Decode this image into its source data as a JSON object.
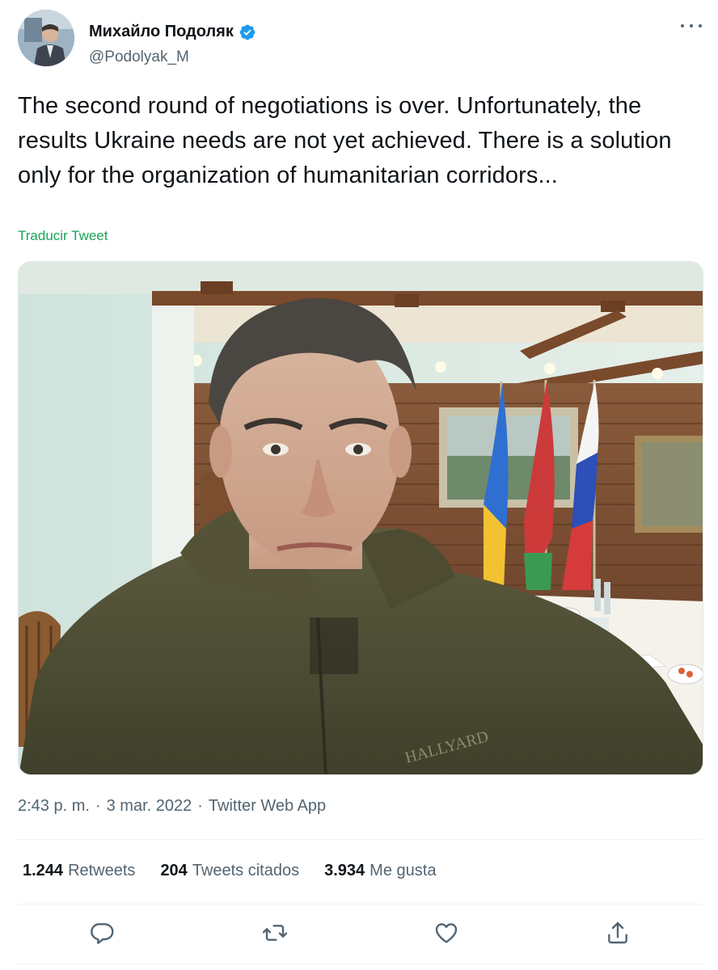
{
  "author": {
    "display_name": "Михайло Подоляк",
    "handle": "@Podolyak_M",
    "verified": true,
    "avatar_icon": "avatar-photo"
  },
  "tweet": {
    "text": "The second round of negotiations is over. Unfortunately, the results Ukraine needs are not yet achieved. There is a solution only for the organization of humanitarian corridors...",
    "translate_label": "Traducir Tweet",
    "media_alt": "photo"
  },
  "meta": {
    "time": "2:43 p. m.",
    "separator": "·",
    "date": "3 mar. 2022",
    "app": "Twitter Web App"
  },
  "stats": [
    {
      "value": "1.244",
      "label": "Retweets"
    },
    {
      "value": "204",
      "label": "Tweets citados"
    },
    {
      "value": "3.934",
      "label": "Me gusta"
    }
  ],
  "actions": [
    {
      "icon": "reply-icon"
    },
    {
      "icon": "retweet-icon"
    },
    {
      "icon": "like-icon"
    },
    {
      "icon": "share-icon"
    }
  ],
  "colors": {
    "verified": "#1d9bf0",
    "translate_link": "#19a35a",
    "secondary_text": "#536471",
    "primary_text": "#0f1419"
  }
}
